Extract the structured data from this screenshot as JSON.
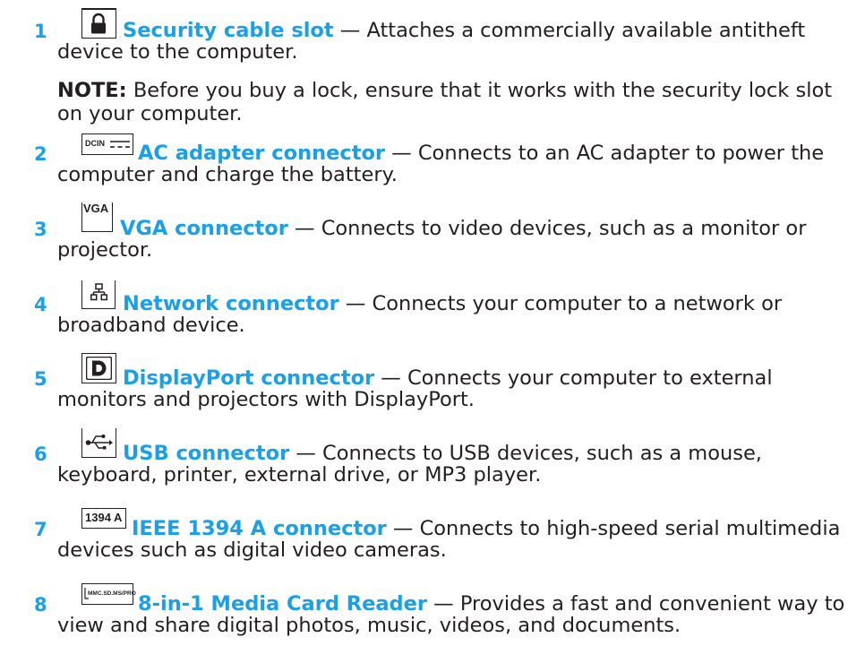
{
  "items": [
    {
      "number": "1",
      "icon": "lock-icon",
      "title": "Security cable slot",
      "separator": " — ",
      "desc1": "Attaches a commercially available antitheft",
      "desc2": "device to the computer.",
      "note_label": "NOTE:",
      "note_line1": " Before you buy a lock, ensure that it works with the security lock slot",
      "note_line2": "on your computer."
    },
    {
      "number": "2",
      "icon": "dc-power-icon",
      "icon_text": "DCIN",
      "title": "AC adapter connector",
      "separator": " — ",
      "desc1": "Connects to an AC adapter to power the",
      "desc2": "computer and charge the battery."
    },
    {
      "number": "3",
      "icon": "vga-icon",
      "icon_text": "VGA",
      "title": "VGA connector",
      "separator": " — ",
      "desc1": "Connects to video devices, such as a monitor or",
      "desc2": "projector."
    },
    {
      "number": "4",
      "icon": "network-icon",
      "title": "Network connector",
      "separator": " — ",
      "desc1": "Connects your computer to a network or",
      "desc2": "broadband device."
    },
    {
      "number": "5",
      "icon": "displayport-icon",
      "title": "DisplayPort connector",
      "separator": " — ",
      "desc1": "Connects your computer to external",
      "desc2": "monitors and projectors with DisplayPort."
    },
    {
      "number": "6",
      "icon": "usb-icon",
      "title": "USB connector",
      "separator": " — ",
      "desc1": "Connects to USB devices, such as a mouse,",
      "desc2": "keyboard, printer, external drive, or MP3 player."
    },
    {
      "number": "7",
      "icon": "ieee1394-icon",
      "icon_text": "1394 A",
      "title": "IEEE 1394 A connector",
      "separator": " — ",
      "desc1": "Connects to high-speed serial multimedia",
      "desc2": "devices such as digital video cameras."
    },
    {
      "number": "8",
      "icon": "media-card-icon",
      "icon_text": "MMC.SD.MS/PRO",
      "title": "8-in-1 Media Card Reader",
      "separator": " — ",
      "desc1": "Provides a fast and convenient way to",
      "desc2": "view and share digital photos, music, videos, and documents."
    }
  ],
  "colors": {
    "accent": "#1aa0e8",
    "text": "#231f20"
  }
}
